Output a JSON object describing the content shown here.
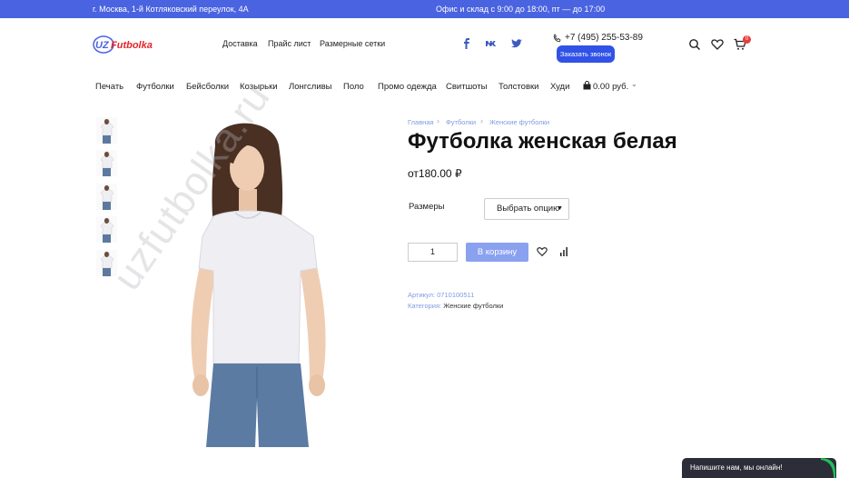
{
  "topbar": {
    "address": "г. Москва, 1-й Котляковский переулок, 4А",
    "hours": "Офис и склад с 9:00 до 18:00, пт — до 17:00"
  },
  "header": {
    "logo_text": "UZFutbolka",
    "nav": [
      "Доставка",
      "Прайс лист",
      "Размерные сетки"
    ],
    "social": [
      "facebook-icon",
      "vk-icon",
      "twitter-icon"
    ],
    "phone": "+7 (495) 255-53-89",
    "callback_label": "Заказать звонок",
    "cart_count": "0"
  },
  "catnav": {
    "items": [
      "Печать",
      "Футболки",
      "Бейсболки",
      "Козырьки",
      "Лонгсливы",
      "Поло",
      "Промо одежда",
      "Свитшоты",
      "Толстовки",
      "Худи"
    ],
    "cart_total": "0.00 руб."
  },
  "breadcrumb": [
    "Главная",
    "Футболки",
    "Женские футболки"
  ],
  "product": {
    "title": "Футболка женская белая",
    "price": "от180.00 ₽",
    "sizes_label": "Размеры",
    "sizes_select": "Выбрать опцию",
    "quantity": "1",
    "add_to_cart": "В корзину",
    "sku_label": "Артикул:",
    "sku": "0710100511",
    "category_label": "Категория:",
    "category": "Женские футболки",
    "watermark": "uzfutbolka.ru"
  },
  "chat": {
    "label": "Напишите нам, мы онлайн!"
  },
  "colors": {
    "brand_blue": "#4a63e0",
    "button_blue": "#3152e6",
    "cart_button": "#8aa1f0",
    "link": "#7f9be0",
    "chat_bg": "#2b2d38",
    "chat_accent": "#1fbf5a"
  }
}
